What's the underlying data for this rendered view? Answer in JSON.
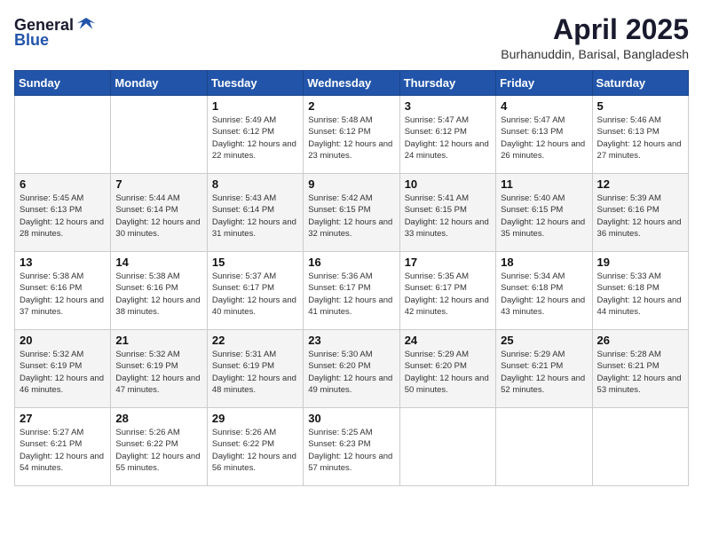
{
  "logo": {
    "general": "General",
    "blue": "Blue"
  },
  "title": "April 2025",
  "location": "Burhanuddin, Barisal, Bangladesh",
  "days_of_week": [
    "Sunday",
    "Monday",
    "Tuesday",
    "Wednesday",
    "Thursday",
    "Friday",
    "Saturday"
  ],
  "weeks": [
    [
      {
        "day": "",
        "info": ""
      },
      {
        "day": "",
        "info": ""
      },
      {
        "day": "1",
        "info": "Sunrise: 5:49 AM\nSunset: 6:12 PM\nDaylight: 12 hours and 22 minutes."
      },
      {
        "day": "2",
        "info": "Sunrise: 5:48 AM\nSunset: 6:12 PM\nDaylight: 12 hours and 23 minutes."
      },
      {
        "day": "3",
        "info": "Sunrise: 5:47 AM\nSunset: 6:12 PM\nDaylight: 12 hours and 24 minutes."
      },
      {
        "day": "4",
        "info": "Sunrise: 5:47 AM\nSunset: 6:13 PM\nDaylight: 12 hours and 26 minutes."
      },
      {
        "day": "5",
        "info": "Sunrise: 5:46 AM\nSunset: 6:13 PM\nDaylight: 12 hours and 27 minutes."
      }
    ],
    [
      {
        "day": "6",
        "info": "Sunrise: 5:45 AM\nSunset: 6:13 PM\nDaylight: 12 hours and 28 minutes."
      },
      {
        "day": "7",
        "info": "Sunrise: 5:44 AM\nSunset: 6:14 PM\nDaylight: 12 hours and 30 minutes."
      },
      {
        "day": "8",
        "info": "Sunrise: 5:43 AM\nSunset: 6:14 PM\nDaylight: 12 hours and 31 minutes."
      },
      {
        "day": "9",
        "info": "Sunrise: 5:42 AM\nSunset: 6:15 PM\nDaylight: 12 hours and 32 minutes."
      },
      {
        "day": "10",
        "info": "Sunrise: 5:41 AM\nSunset: 6:15 PM\nDaylight: 12 hours and 33 minutes."
      },
      {
        "day": "11",
        "info": "Sunrise: 5:40 AM\nSunset: 6:15 PM\nDaylight: 12 hours and 35 minutes."
      },
      {
        "day": "12",
        "info": "Sunrise: 5:39 AM\nSunset: 6:16 PM\nDaylight: 12 hours and 36 minutes."
      }
    ],
    [
      {
        "day": "13",
        "info": "Sunrise: 5:38 AM\nSunset: 6:16 PM\nDaylight: 12 hours and 37 minutes."
      },
      {
        "day": "14",
        "info": "Sunrise: 5:38 AM\nSunset: 6:16 PM\nDaylight: 12 hours and 38 minutes."
      },
      {
        "day": "15",
        "info": "Sunrise: 5:37 AM\nSunset: 6:17 PM\nDaylight: 12 hours and 40 minutes."
      },
      {
        "day": "16",
        "info": "Sunrise: 5:36 AM\nSunset: 6:17 PM\nDaylight: 12 hours and 41 minutes."
      },
      {
        "day": "17",
        "info": "Sunrise: 5:35 AM\nSunset: 6:17 PM\nDaylight: 12 hours and 42 minutes."
      },
      {
        "day": "18",
        "info": "Sunrise: 5:34 AM\nSunset: 6:18 PM\nDaylight: 12 hours and 43 minutes."
      },
      {
        "day": "19",
        "info": "Sunrise: 5:33 AM\nSunset: 6:18 PM\nDaylight: 12 hours and 44 minutes."
      }
    ],
    [
      {
        "day": "20",
        "info": "Sunrise: 5:32 AM\nSunset: 6:19 PM\nDaylight: 12 hours and 46 minutes."
      },
      {
        "day": "21",
        "info": "Sunrise: 5:32 AM\nSunset: 6:19 PM\nDaylight: 12 hours and 47 minutes."
      },
      {
        "day": "22",
        "info": "Sunrise: 5:31 AM\nSunset: 6:19 PM\nDaylight: 12 hours and 48 minutes."
      },
      {
        "day": "23",
        "info": "Sunrise: 5:30 AM\nSunset: 6:20 PM\nDaylight: 12 hours and 49 minutes."
      },
      {
        "day": "24",
        "info": "Sunrise: 5:29 AM\nSunset: 6:20 PM\nDaylight: 12 hours and 50 minutes."
      },
      {
        "day": "25",
        "info": "Sunrise: 5:29 AM\nSunset: 6:21 PM\nDaylight: 12 hours and 52 minutes."
      },
      {
        "day": "26",
        "info": "Sunrise: 5:28 AM\nSunset: 6:21 PM\nDaylight: 12 hours and 53 minutes."
      }
    ],
    [
      {
        "day": "27",
        "info": "Sunrise: 5:27 AM\nSunset: 6:21 PM\nDaylight: 12 hours and 54 minutes."
      },
      {
        "day": "28",
        "info": "Sunrise: 5:26 AM\nSunset: 6:22 PM\nDaylight: 12 hours and 55 minutes."
      },
      {
        "day": "29",
        "info": "Sunrise: 5:26 AM\nSunset: 6:22 PM\nDaylight: 12 hours and 56 minutes."
      },
      {
        "day": "30",
        "info": "Sunrise: 5:25 AM\nSunset: 6:23 PM\nDaylight: 12 hours and 57 minutes."
      },
      {
        "day": "",
        "info": ""
      },
      {
        "day": "",
        "info": ""
      },
      {
        "day": "",
        "info": ""
      }
    ]
  ]
}
